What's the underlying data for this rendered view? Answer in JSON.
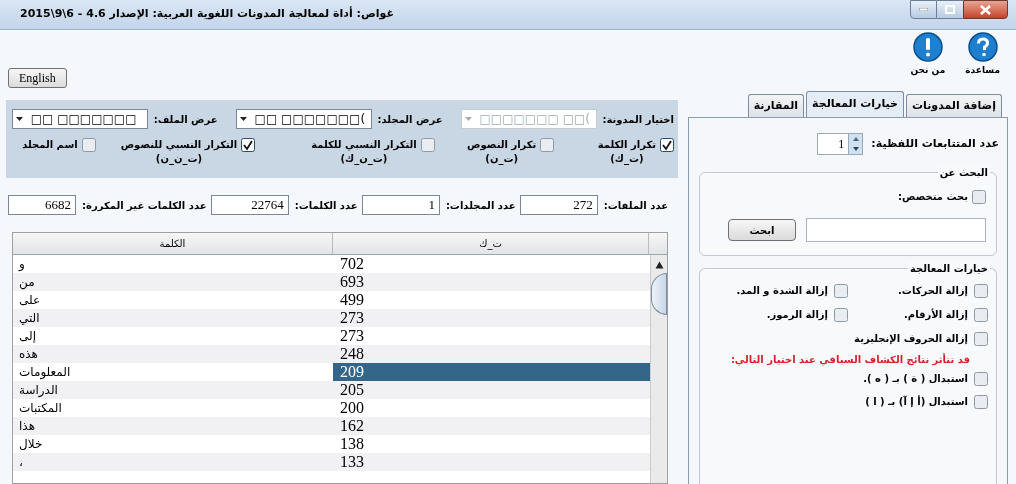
{
  "window": {
    "title": "غواص: أداة لمعالجة المدونات اللغوية العربية: الإصدار 4.6 - 6\\9\\2015"
  },
  "top_buttons": [
    {
      "kind": "help",
      "label": "مساعدة"
    },
    {
      "kind": "about",
      "label": "من نحن"
    }
  ],
  "language_button": "English",
  "tabs": [
    {
      "label": "إضافة المدونات",
      "selected": false
    },
    {
      "label": "خيارات المعالجة",
      "selected": true
    },
    {
      "label": "المقارنة",
      "selected": false
    }
  ],
  "sequence_count": {
    "label": "عدد المتتابعات اللفظية:",
    "value": "1"
  },
  "search_group": {
    "title": "البحث عن",
    "advanced": {
      "label": "بحث متخصص:",
      "checked": false
    },
    "button": "ابحث"
  },
  "processing_group": {
    "title": "خيارات المعالجة",
    "option_rows": [
      [
        {
          "label": "إزالة الحركات.",
          "checked": false
        },
        {
          "label": "إزالة الشدة و المد.",
          "checked": false
        }
      ],
      [
        {
          "label": "إزالة الأرقام.",
          "checked": false
        },
        {
          "label": "إزالة الرموز.",
          "checked": false
        }
      ],
      [
        {
          "label": "إزالة الحروف الإنجليزية",
          "checked": false
        }
      ]
    ],
    "warning": "قد تتأثر نتائج الكشاف السياقي عند اختيار التالي:",
    "replacements": [
      {
        "label": "استبدال ( ة ) بـ ( ه ).",
        "checked": false
      },
      {
        "label": "استبدال (أ إ آ) بـ ( ا )",
        "checked": false
      }
    ]
  },
  "selectors": [
    {
      "label": "اختيار المدونة:",
      "value": "□□□□□□□ □□(",
      "disabled": true
    },
    {
      "label": "عرض المجلد:",
      "value": "□□ □□□□□□□(",
      "disabled": false
    },
    {
      "label": "عرض الملف:",
      "value": "□□ □□□□□□□",
      "disabled": false
    }
  ],
  "stat_checks": [
    {
      "label": "تكرار الكلمة",
      "sublabel": "(ت_ك)",
      "checked": true
    },
    {
      "label": "تكرار النصوص",
      "sublabel": "(ت_ن)",
      "checked": false
    },
    {
      "label": "التكرار النسبي للكلمة",
      "sublabel": "(ت_ن_ك)",
      "checked": false
    },
    {
      "label": "التكرار النسبي للنصوص",
      "sublabel": "(ت_ن_ن)",
      "checked": true
    },
    {
      "label": "اسم المجلد",
      "checked": false
    }
  ],
  "counts": [
    {
      "label": "عدد الملفات:",
      "value": "272"
    },
    {
      "label": "عدد المجلدات:",
      "value": "1"
    },
    {
      "label": "عدد الكلمات:",
      "value": "22764"
    },
    {
      "label": "عدد الكلمات غير المكررة:",
      "value": "6682"
    }
  ],
  "table": {
    "columns": [
      "ت_ك",
      "الكلمة"
    ],
    "rows": [
      {
        "word": "و",
        "count": "702",
        "selected": false
      },
      {
        "word": "من",
        "count": "693",
        "selected": false
      },
      {
        "word": "على",
        "count": "499",
        "selected": false
      },
      {
        "word": "التي",
        "count": "273",
        "selected": false
      },
      {
        "word": "إلى",
        "count": "273",
        "selected": false
      },
      {
        "word": "هذه",
        "count": "248",
        "selected": false
      },
      {
        "word": "المعلومات",
        "count": "209",
        "selected": true
      },
      {
        "word": "الدراسة",
        "count": "205",
        "selected": false
      },
      {
        "word": "المكتبات",
        "count": "200",
        "selected": false
      },
      {
        "word": "هذا",
        "count": "162",
        "selected": false
      },
      {
        "word": "خلال",
        "count": "138",
        "selected": false
      },
      {
        "word": "،",
        "count": "133",
        "selected": false
      }
    ]
  }
}
